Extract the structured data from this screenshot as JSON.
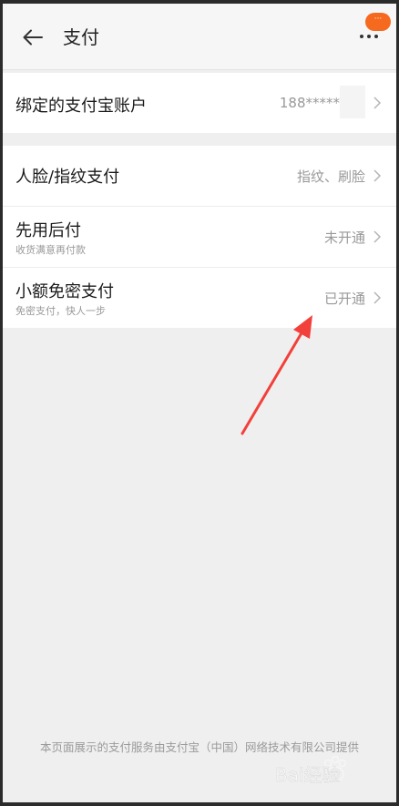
{
  "header": {
    "title": "支付",
    "badge_text": "···"
  },
  "groups": [
    {
      "rows": [
        {
          "title": "绑定的支付宝账户",
          "value": "188*****"
        }
      ]
    },
    {
      "rows": [
        {
          "title": "人脸/指纹支付",
          "value": "指纹、刷脸"
        },
        {
          "title": "先用后付",
          "subtitle": "收货满意再付款",
          "value": "未开通"
        },
        {
          "title": "小额免密支付",
          "subtitle": "免密支付，快人一步",
          "value": "已开通"
        }
      ]
    }
  ],
  "footer": {
    "text": "本页面展示的支付服务由支付宝（中国）网络技术有限公司提供"
  },
  "watermark": {
    "text": "Bai经验"
  },
  "colors": {
    "accent_badge": "#f56a1e",
    "annotation_arrow": "#f2403a",
    "background": "#efefef"
  }
}
